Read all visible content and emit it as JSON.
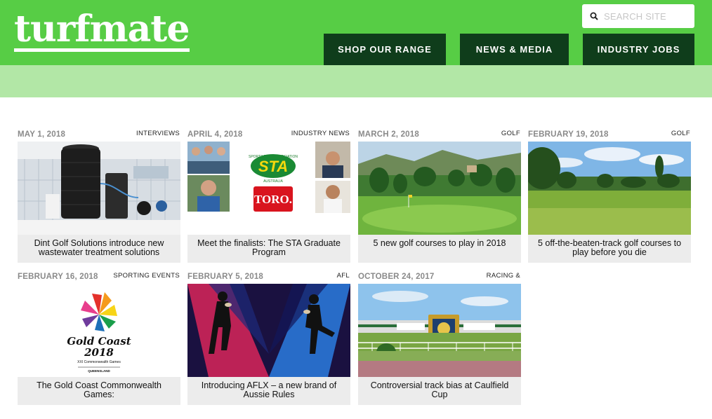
{
  "header": {
    "logo": "turfmate",
    "search_placeholder": "SEARCH SITE",
    "nav": [
      {
        "label": "SHOP OUR RANGE"
      },
      {
        "label": "NEWS & MEDIA"
      },
      {
        "label": "INDUSTRY JOBS"
      }
    ]
  },
  "colors": {
    "header_green": "#57cd45",
    "subbar_green": "#b2e7a6",
    "nav_dark_green": "#0f3d1b",
    "title_bg": "#ececec"
  },
  "articles": [
    {
      "date": "MAY 1, 2018",
      "category": "INTERVIEWS",
      "title": "Dint Golf Solutions introduce new wastewater treatment solutions",
      "image": "water-treatment-unit-photo"
    },
    {
      "date": "APRIL 4, 2018",
      "category": "INDUSTRY NEWS",
      "title": "Meet the finalists: The STA Graduate Program",
      "image": "sta-toro-finalists-collage",
      "image_text": {
        "sta_ring": "SPORTS TURF ASSOCIATION",
        "sta": "STA",
        "sta_country": "AUSTRALIA",
        "toro": "TORO."
      }
    },
    {
      "date": "MARCH 2, 2018",
      "category": "GOLF",
      "title": "5 new golf courses to play in 2018",
      "image": "golf-course-green-photo"
    },
    {
      "date": "FEBRUARY 19, 2018",
      "category": "GOLF",
      "title": "5 off-the-beaten-track golf courses to play before you die",
      "image": "golf-fairway-photo"
    },
    {
      "date": "FEBRUARY 16, 2018",
      "category": "SPORTING EVENTS",
      "title": "The Gold Coast Commonwealth Games:",
      "image": "gold-coast-2018-logo",
      "image_text": {
        "line1": "Gold Coast",
        "line2": "2018",
        "line3": "XXI Commonwealth Games",
        "line4": "QUEENSLAND"
      }
    },
    {
      "date": "FEBRUARY 5, 2018",
      "category": "AFL",
      "title": "Introducing AFLX – a new brand of Aussie Rules",
      "image": "aflx-players-graphic"
    },
    {
      "date": "OCTOBER 24, 2017",
      "category": "RACING &",
      "title": "Controversial track bias at Caulfield Cup",
      "image": "caulfield-racecourse-photo"
    }
  ]
}
